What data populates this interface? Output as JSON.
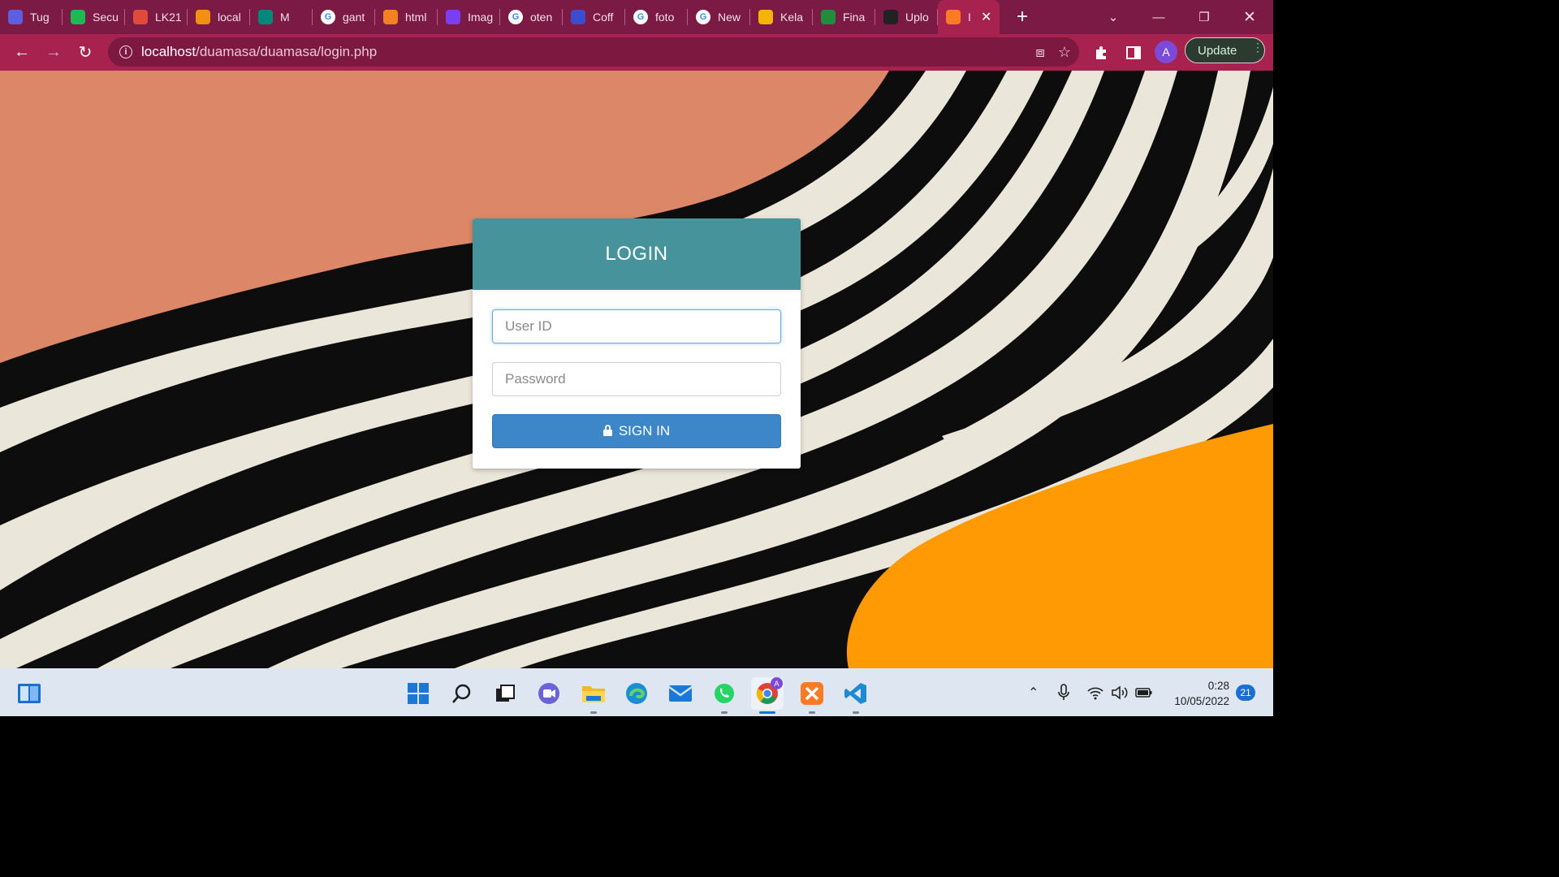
{
  "browser": {
    "tabs": [
      {
        "title": "Tug",
        "icon": "list-icon",
        "color": "#5b5fe0"
      },
      {
        "title": "Secu",
        "icon": "spotify-icon",
        "color": "#1db954"
      },
      {
        "title": "LK21",
        "icon": "film-icon",
        "color": "#e04a3a"
      },
      {
        "title": "local",
        "icon": "phpmyadmin-icon",
        "color": "#f29111"
      },
      {
        "title": "M",
        "icon": "meet-icon",
        "color": "#00897b"
      },
      {
        "title": "gant",
        "icon": "google-icon",
        "color": "#ffffff"
      },
      {
        "title": "html",
        "icon": "stackoverflow-icon",
        "color": "#f48024"
      },
      {
        "title": "Imag",
        "icon": "bootstrap-icon",
        "color": "#7a3ff2"
      },
      {
        "title": "oten",
        "icon": "google-icon",
        "color": "#ffffff"
      },
      {
        "title": "Coff",
        "icon": "upwork-icon",
        "color": "#3b4ccf"
      },
      {
        "title": "foto",
        "icon": "google-icon",
        "color": "#ffffff"
      },
      {
        "title": "New",
        "icon": "chrome-icon",
        "color": "#ffffff"
      },
      {
        "title": "Kela",
        "icon": "classroom-icon",
        "color": "#f4b400"
      },
      {
        "title": "Fina",
        "icon": "classroom-icon",
        "color": "#1e8e3e"
      },
      {
        "title": "Uplo",
        "icon": "github-icon",
        "color": "#222222"
      },
      {
        "title": "I",
        "icon": "xampp-icon",
        "color": "#fb7a24"
      }
    ],
    "new_tab_label": "+",
    "url_host": "localhost",
    "url_path": "/duamasa/duamasa/login.php",
    "profile_initial": "A",
    "update_label": "Update"
  },
  "login": {
    "title": "LOGIN",
    "userid_placeholder": "User ID",
    "password_placeholder": "Password",
    "signin_label": "SIGN IN"
  },
  "taskbar": {
    "time": "0:28",
    "date": "10/05/2022",
    "notification_count": "21",
    "chrome_badge": "A"
  },
  "colors": {
    "tabstrip": "#7a1a45",
    "toolbar": "#a8224f",
    "login_header": "#46939c",
    "signin_button": "#3d87c8",
    "bg_salmon": "#dc8767",
    "bg_orange": "#ff9a05",
    "bg_cream": "#ebe6da"
  }
}
